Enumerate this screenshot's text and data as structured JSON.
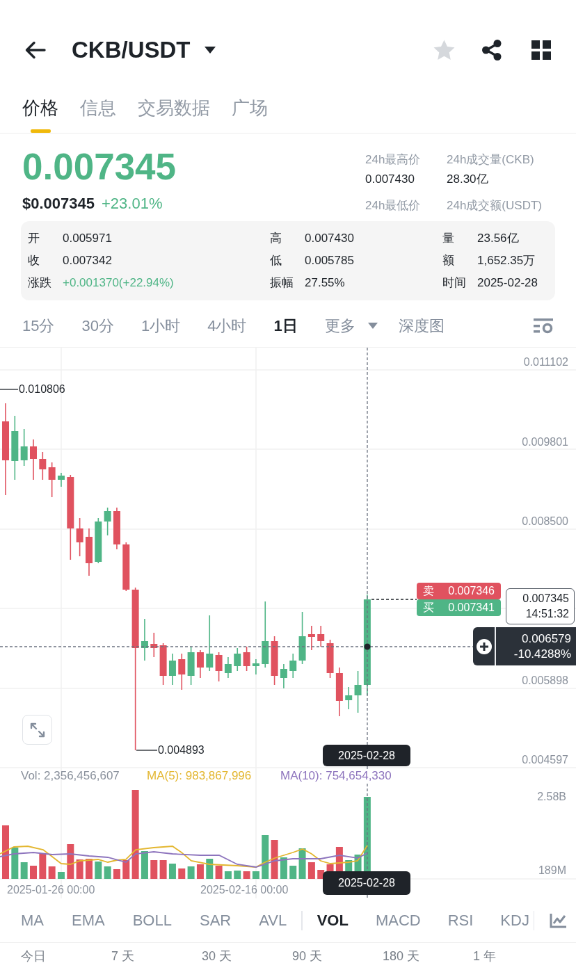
{
  "header": {
    "title": "CKB/USDT"
  },
  "tabs": [
    {
      "label": "价格",
      "selected": true
    },
    {
      "label": "信息",
      "selected": false
    },
    {
      "label": "交易数据",
      "selected": false
    },
    {
      "label": "广场",
      "selected": false
    }
  ],
  "price": {
    "last": "0.007345",
    "usd": "$0.007345",
    "change": "+23.01%"
  },
  "stats_24h": [
    {
      "label": "24h最高价",
      "value": "0.007430"
    },
    {
      "label": "24h成交量(CKB)",
      "value": "28.30亿"
    },
    {
      "label": "24h最低价"
    },
    {
      "label": "24h成交额(USDT)"
    }
  ],
  "candle_info": [
    [
      {
        "label": "开",
        "value": "0.005971",
        "kind": "plain"
      },
      {
        "label": "高",
        "value": "0.007430",
        "kind": "plain"
      },
      {
        "label": "量",
        "value": "23.56亿",
        "kind": "plain"
      }
    ],
    [
      {
        "label": "收",
        "value": "0.007342",
        "kind": "plain"
      },
      {
        "label": "低",
        "value": "0.005785",
        "kind": "plain"
      },
      {
        "label": "额",
        "value": "1,652.35万",
        "kind": "plain"
      }
    ],
    [
      {
        "label": "涨跌",
        "value": "+0.001370(+22.94%)",
        "kind": "change"
      },
      {
        "label": "振幅",
        "value": "27.55%",
        "kind": "plain"
      },
      {
        "label": "时间",
        "value": "2025-02-28",
        "kind": "plain"
      }
    ]
  ],
  "intervals": [
    {
      "label": "15分",
      "selected": false
    },
    {
      "label": "30分",
      "selected": false
    },
    {
      "label": "1小时",
      "selected": false
    },
    {
      "label": "4小时",
      "selected": false
    },
    {
      "label": "1日",
      "selected": true
    }
  ],
  "more": {
    "label": "更多"
  },
  "depth_chart": {
    "label": "深度图"
  },
  "chart": {
    "price_axis": [
      "0.011102",
      "0.009801",
      "0.008500",
      "0.005898",
      "0.004597"
    ],
    "high_marker": "0.010806",
    "low_marker": "0.004893",
    "quotes": [
      {
        "kind": "sell",
        "side": "卖",
        "price": "0.007346"
      },
      {
        "kind": "buy",
        "side": "买",
        "price": "0.007341"
      }
    ],
    "last_price": {
      "price": "0.007345",
      "countdown": "14:51:32"
    },
    "crosshair": {
      "price": "0.006579",
      "change": "-10.4288%",
      "date": "2025-02-28"
    }
  },
  "volume": {
    "legend": [
      {
        "label": "Vol: 2,356,456,607",
        "color": "#8a919c"
      },
      {
        "label": "MA(5): 983,867,996",
        "color": "#e3b62f"
      },
      {
        "label": "MA(10): 754,654,330",
        "color": "#8d74bd"
      }
    ],
    "axis": [
      "2.58B",
      "189M"
    ],
    "dates": [
      "2025-01-26 00:00",
      "2025-02-16 00:00"
    ],
    "crosshair_date": "2025-02-28"
  },
  "main_indicators": [
    {
      "label": "MA",
      "selected": false
    },
    {
      "label": "EMA",
      "selected": false
    },
    {
      "label": "BOLL",
      "selected": false
    },
    {
      "label": "SAR",
      "selected": false
    },
    {
      "label": "AVL",
      "selected": false
    }
  ],
  "sub_indicators": [
    {
      "label": "VOL",
      "selected": true
    },
    {
      "label": "MACD",
      "selected": false
    },
    {
      "label": "RSI",
      "selected": false
    },
    {
      "label": "KDJ",
      "selected": false
    }
  ],
  "ranges": [
    "今日",
    "7 天",
    "30 天",
    "90 天",
    "180 天",
    "1 年"
  ]
}
